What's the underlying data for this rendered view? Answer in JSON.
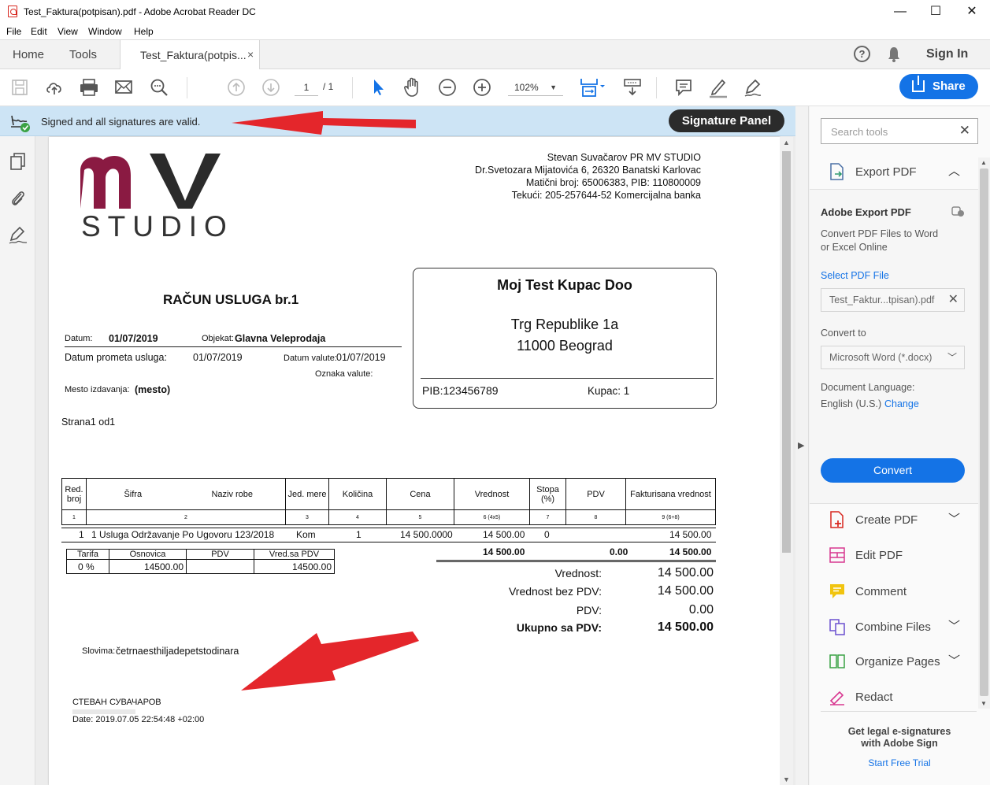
{
  "window": {
    "title": "Test_Faktura(potpisan).pdf - Adobe Acrobat Reader DC",
    "minimize": "—",
    "maximize": "☐",
    "close": "✕"
  },
  "menu": [
    "File",
    "Edit",
    "View",
    "Window",
    "Help"
  ],
  "tabs": {
    "home": "Home",
    "tools": "Tools",
    "document": "Test_Faktura(potpis...",
    "close": "×",
    "help": "?",
    "sign_in": "Sign In"
  },
  "toolbar": {
    "page_current": "1",
    "page_total": "/ 1",
    "zoom": "102%",
    "share": "Share"
  },
  "signature_bar": {
    "status": "Signed and all signatures are valid.",
    "panel_button": "Signature Panel"
  },
  "invoice": {
    "seller": {
      "name": "Stevan Suvačarov PR MV STUDIO",
      "address": "Dr.Svetozara Mijatovića 6, 26320 Banatski Karlovac",
      "ids": "Matični broj: 65006383, PIB: 110800009",
      "bank": "Tekući: 205-257644-52 Komercijalna banka"
    },
    "logo_text": "STUDIO",
    "title": "RAČUN USLUGA br.1",
    "datum_label": "Datum:",
    "datum_value": "01/07/2019",
    "objekat_label": "Objekat:",
    "objekat_value": "Glavna Veleprodaja",
    "datum_prometa_label": "Datum prometa usluga:",
    "datum_prometa_value": "01/07/2019",
    "datum_valute_label": "Datum valute:",
    "datum_valute_value": "01/07/2019",
    "oznaka_valute_label": "Oznaka valute:",
    "mesto_label": "Mesto izdavanja:",
    "mesto_value": "(mesto)",
    "strana": "Strana1 od1",
    "buyer": {
      "name": "Moj Test Kupac Doo",
      "street": "Trg Republike 1a",
      "city": "11000 Beograd",
      "pib": "PIB:123456789",
      "kupac": "Kupac: 1"
    },
    "table_headers": [
      "Red. broj",
      "Šifra",
      "Naziv robe",
      "Jed. mere",
      "Količina",
      "Cena",
      "Vrednost",
      "Stopa (%)",
      "PDV",
      "Fakturisana vrednost"
    ],
    "table_numbers": [
      "1",
      "2",
      "3",
      "4",
      "5",
      "6 (4x5)",
      "7",
      "8",
      "9 (6+8)"
    ],
    "item": {
      "rb": "1",
      "sifra_naziv": "1 Usluga Održavanje Po Ugovoru 123/2018",
      "jm": "Kom",
      "kolicina": "1",
      "cena": "14 500.0000",
      "vrednost": "14 500.00",
      "stopa": "0",
      "fakturisana": "14 500.00"
    },
    "subtotal": {
      "vrednost": "14 500.00",
      "pdv": "0.00",
      "fakturisana": "14 500.00"
    },
    "tax_table": {
      "headers": [
        "Tarifa",
        "Osnovica",
        "PDV",
        "Vred.sa PDV"
      ],
      "row": [
        "0 %",
        "14500.00",
        "",
        "14500.00"
      ]
    },
    "totals": [
      {
        "label": "Vrednost:",
        "value": "14 500.00"
      },
      {
        "label": "Vrednost bez PDV:",
        "value": "14 500.00"
      },
      {
        "label": "PDV:",
        "value": "0.00"
      },
      {
        "label": "Ukupno sa PDV:",
        "value": "14 500.00"
      }
    ],
    "slovima_label": "Slovima:",
    "slovima_value": "četrnaesthiljadepetstodinara",
    "signature_name": "СТЕВАН СУВАЧАРОВ",
    "signature_date": "Date: 2019.07.05 22:54:48 +02:00"
  },
  "right_panel": {
    "search_placeholder": "Search tools",
    "export_pdf": "Export PDF",
    "adobe_export_title": "Adobe Export PDF",
    "adobe_export_desc1": "Convert PDF Files to Word",
    "adobe_export_desc2": "or Excel Online",
    "select_file": "Select PDF File",
    "file_name": "Test_Faktur...tpisan).pdf",
    "convert_to": "Convert to",
    "format": "Microsoft Word (*.docx)",
    "doc_language": "Document Language:",
    "language": "English (U.S.)",
    "change": "Change",
    "convert": "Convert",
    "tools": [
      "Create PDF",
      "Edit PDF",
      "Comment",
      "Combine Files",
      "Organize Pages",
      "Redact"
    ],
    "promo_line1": "Get legal e-signatures",
    "promo_line2": "with Adobe Sign",
    "trial": "Start Free Trial"
  }
}
